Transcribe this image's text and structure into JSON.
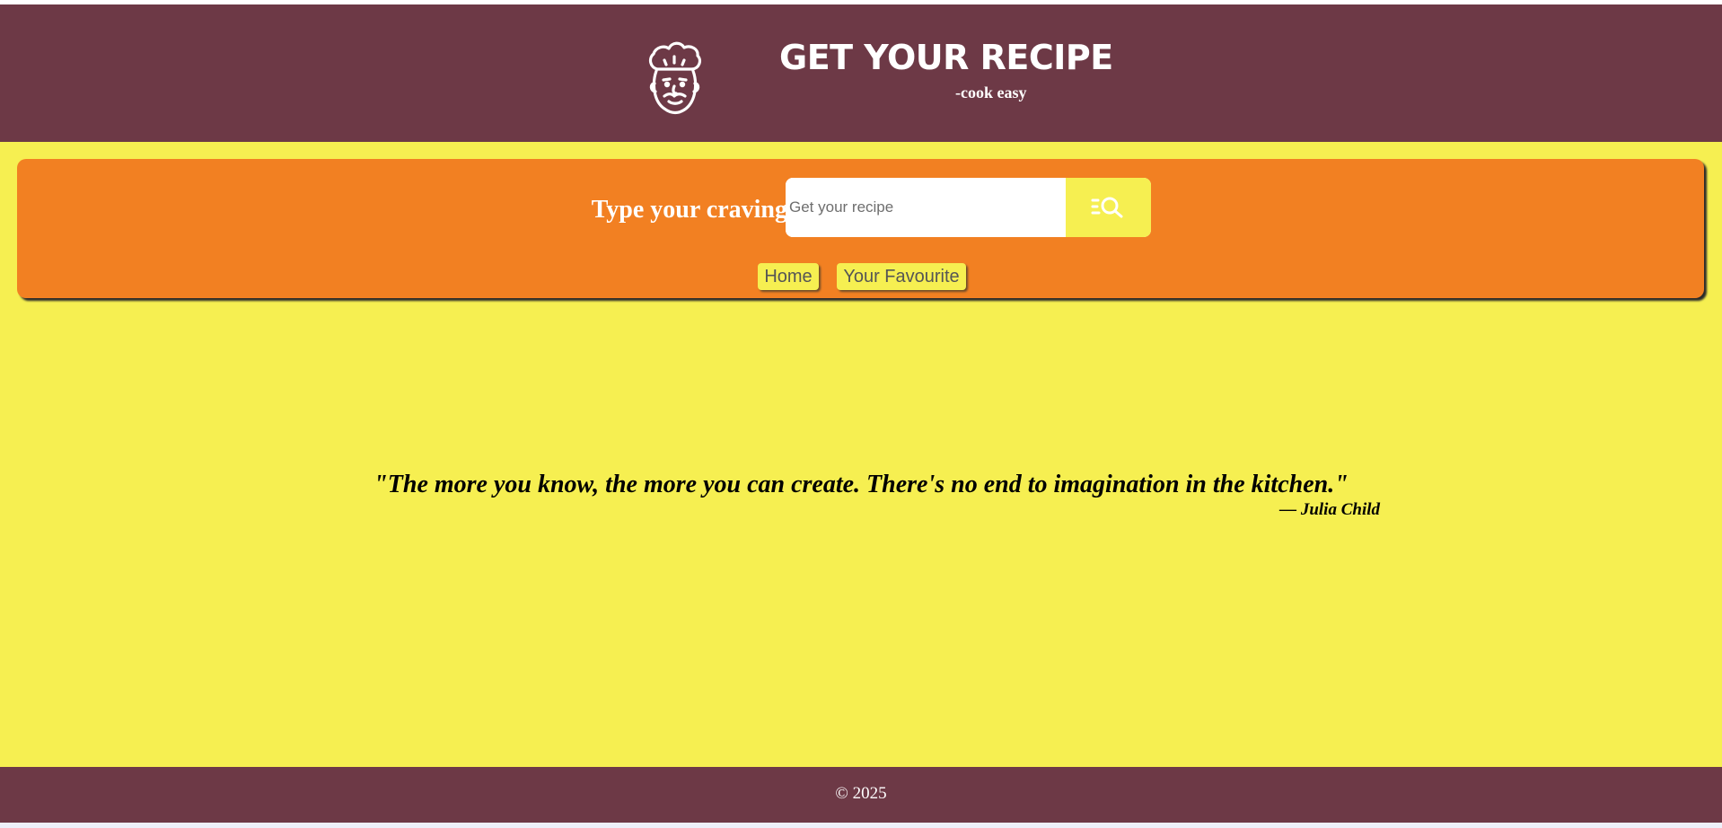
{
  "header": {
    "logo_icon": "chef-face-icon",
    "title": "GET YOUR RECIPE",
    "tagline": "-cook easy"
  },
  "search": {
    "label": "Type your craving",
    "placeholder": "Get your recipe",
    "value": "",
    "button_icon": "list-search-icon"
  },
  "nav": {
    "items": [
      {
        "label": "Home"
      },
      {
        "label": "Your Favourite"
      }
    ]
  },
  "quote": {
    "text": "\"The more you know, the more you can create. There's no end to imagination in the kitchen.\"",
    "author": "— Julia Child"
  },
  "footer": {
    "copyright": "© 2025"
  },
  "colors": {
    "header_bg": "#6d3946",
    "page_bg": "#f6ef51",
    "panel_bg": "#f28022",
    "text_light": "#ffffff"
  }
}
